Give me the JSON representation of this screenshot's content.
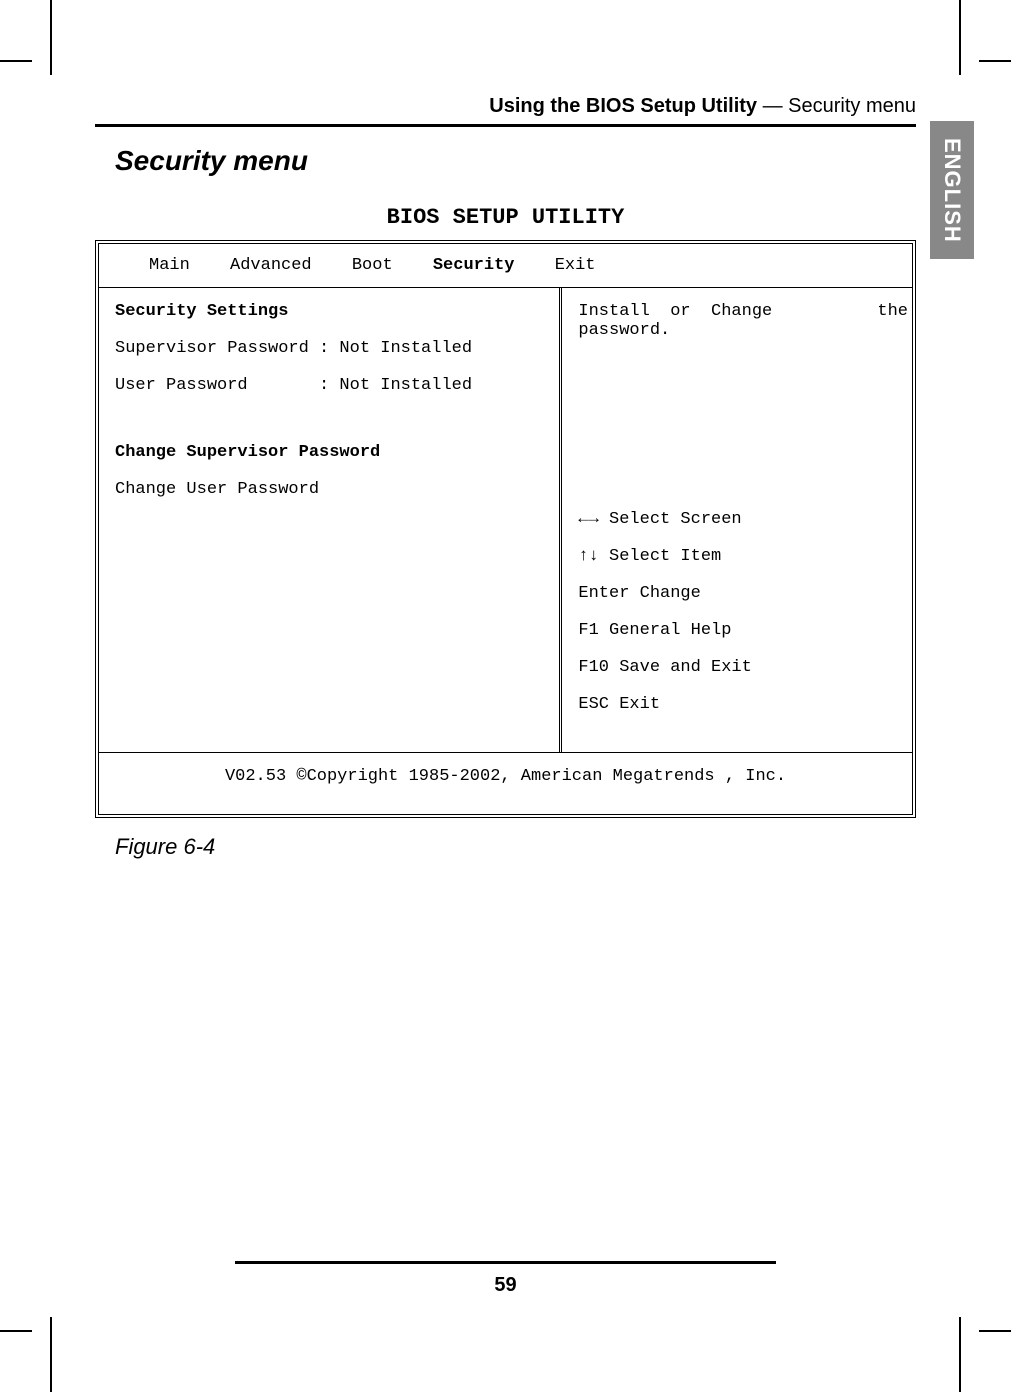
{
  "header": {
    "title_bold": "Using the BIOS Setup Utility",
    "title_rest": " — Security menu"
  },
  "lang_tab": "ENGLISH",
  "section_title": "Security menu",
  "bios_title": "BIOS SETUP UTILITY",
  "menu": {
    "main": "Main",
    "advanced": "Advanced",
    "boot": "Boot",
    "security": "Security",
    "exit": "Exit"
  },
  "left": {
    "heading": "Security Settings",
    "row1": "Supervisor Password : Not Installed",
    "row2": "User Password       : Not Installed",
    "change_sup": "Change Supervisor Password",
    "change_user": "Change User Password"
  },
  "right": {
    "help1a": "Install  or  Change",
    "help1b": "the",
    "help2": "password.",
    "k1": "←→ Select Screen",
    "k2": "↑↓ Select Item",
    "k3": "Enter Change",
    "k4": "F1  General Help",
    "k5": "F10 Save and Exit",
    "k6": "ESC Exit"
  },
  "footer": "V02.53 ©Copyright 1985-2002, American Megatrends , Inc.",
  "figure": "Figure 6-4",
  "page_number": "59"
}
